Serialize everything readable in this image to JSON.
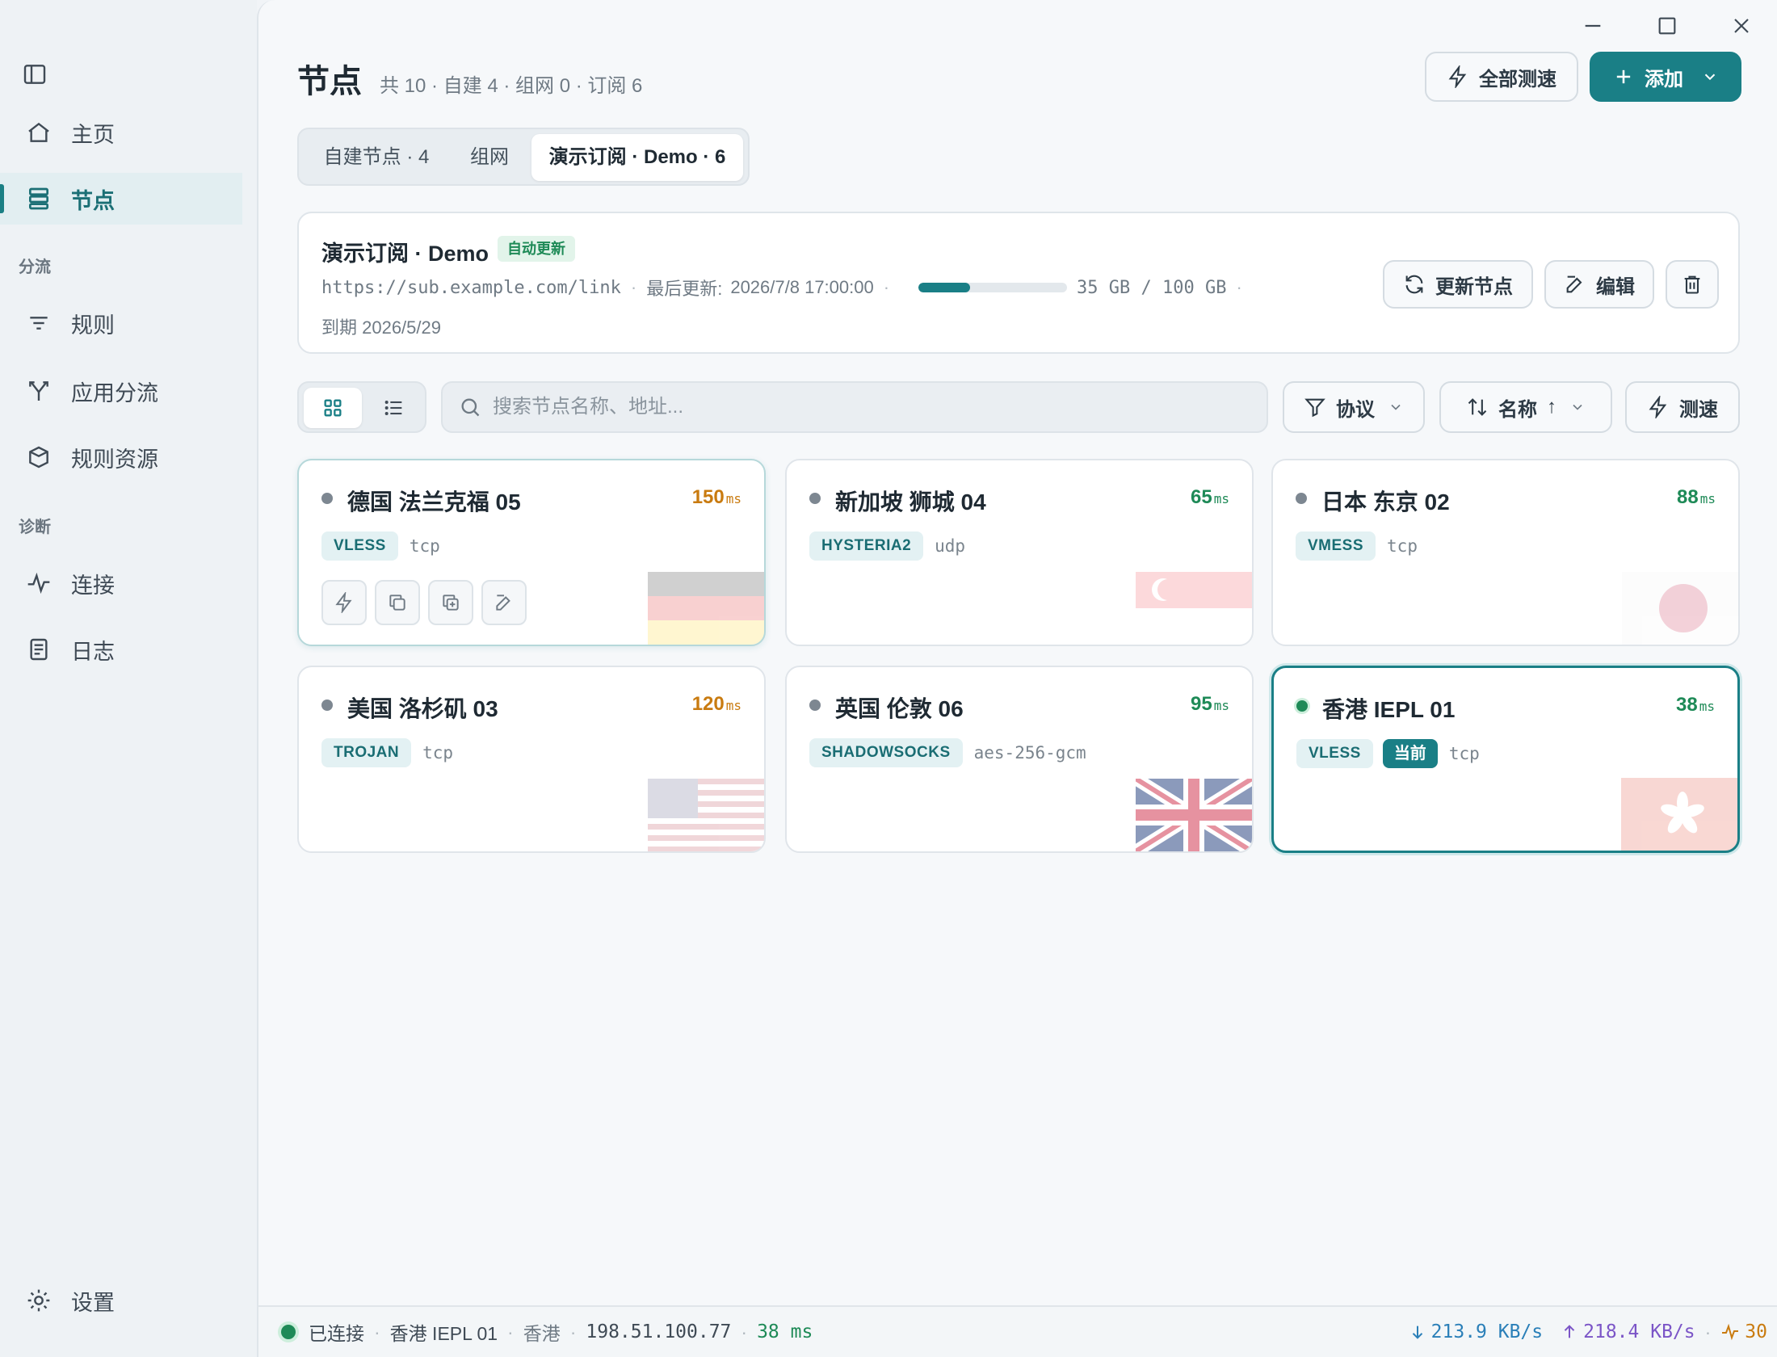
{
  "sidebar": {
    "items": [
      {
        "label": "主页",
        "icon": "home-icon"
      },
      {
        "label": "节点",
        "icon": "server-icon"
      },
      {
        "label": "规则",
        "icon": "filter-lines-icon"
      },
      {
        "label": "应用分流",
        "icon": "split-icon"
      },
      {
        "label": "规则资源",
        "icon": "package-icon"
      },
      {
        "label": "连接",
        "icon": "activity-icon"
      },
      {
        "label": "日志",
        "icon": "log-icon"
      },
      {
        "label": "设置",
        "icon": "settings-icon"
      }
    ],
    "sections": {
      "routing": "分流",
      "diagnostics": "诊断"
    }
  },
  "header": {
    "title": "节点",
    "summary": "共 10 · 自建 4 · 组网 0 · 订阅 6",
    "speedtest_all": "全部测速",
    "add": "添加"
  },
  "tabs": [
    {
      "label": "自建节点 · 4"
    },
    {
      "label": "组网"
    },
    {
      "label": "演示订阅 · Demo · 6"
    }
  ],
  "subscription": {
    "name": "演示订阅 · Demo",
    "auto_update": "自动更新",
    "url": "https://sub.example.com/link",
    "last_update_label": "最后更新:",
    "last_update": "2026/7/8 17:00:00",
    "usage": "35 GB / 100 GB",
    "usage_fraction": 0.35,
    "expire": "到期 2026/5/29",
    "update_nodes": "更新节点",
    "edit": "编辑"
  },
  "toolbar": {
    "search_placeholder": "搜索节点名称、地址...",
    "protocol": "协议",
    "sort": "名称",
    "sort_arrow": "↑",
    "speedtest": "测速"
  },
  "nodes": [
    {
      "name": "德国 法兰克福 05",
      "latency": "150",
      "unit": "ms",
      "protocol": "VLESS",
      "transport": "tcp",
      "flag": "germany-flag"
    },
    {
      "name": "新加坡 狮城 04",
      "latency": "65",
      "unit": "ms",
      "protocol": "HYSTERIA2",
      "transport": "udp",
      "flag": "singapore-flag"
    },
    {
      "name": "日本 东京 02",
      "latency": "88",
      "unit": "ms",
      "protocol": "VMESS",
      "transport": "tcp",
      "flag": "japan-flag"
    },
    {
      "name": "美国 洛杉矶 03",
      "latency": "120",
      "unit": "ms",
      "protocol": "TROJAN",
      "transport": "tcp",
      "flag": "usa-flag"
    },
    {
      "name": "英国 伦敦 06",
      "latency": "95",
      "unit": "ms",
      "protocol": "SHADOWSOCKS",
      "transport": "aes-256-gcm",
      "flag": "uk-flag"
    },
    {
      "name": "香港 IEPL 01",
      "latency": "38",
      "unit": "ms",
      "protocol": "VLESS",
      "current_label": "当前",
      "transport": "tcp",
      "flag": "hongkong-flag"
    }
  ],
  "statusbar": {
    "state": "已连接",
    "node": "香港 IEPL 01",
    "region": "香港",
    "ip": "198.51.100.77",
    "latency": "38 ms",
    "download": "213.9 KB/s",
    "upload": "218.4 KB/s",
    "connections": "30"
  },
  "colors": {
    "accent": "#1a7f86",
    "good": "#1e8a57",
    "warn": "#c97b10"
  }
}
